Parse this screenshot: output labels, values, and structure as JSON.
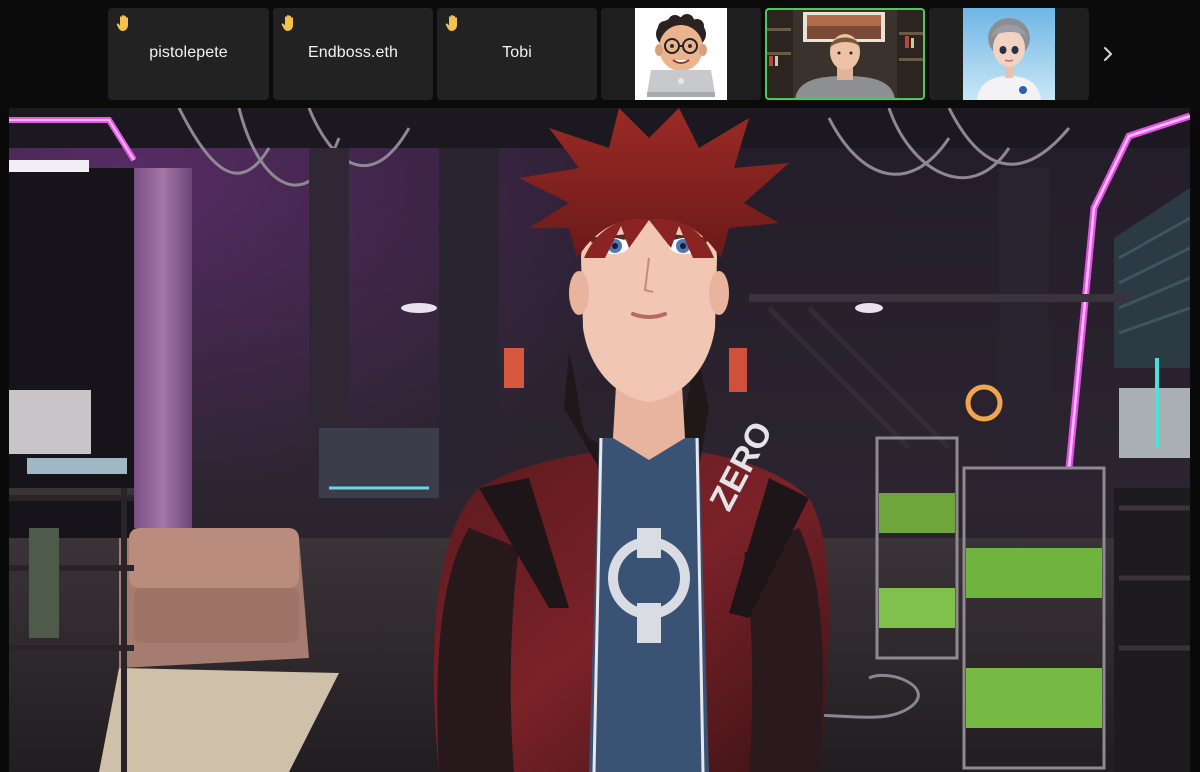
{
  "participants": [
    {
      "name": "pistolepete",
      "raised_hand": true,
      "type": "name-tile"
    },
    {
      "name": "Endboss.eth",
      "raised_hand": true,
      "type": "name-tile"
    },
    {
      "name": "Tobi",
      "raised_hand": true,
      "type": "name-tile"
    },
    {
      "name": "",
      "raised_hand": false,
      "type": "empty-tile"
    },
    {
      "name": "",
      "raised_hand": false,
      "type": "memoji-avatar"
    },
    {
      "name": "",
      "raised_hand": false,
      "type": "webcam-video",
      "active_speaker": true
    },
    {
      "name": "",
      "raised_hand": false,
      "type": "3d-avatar"
    }
  ],
  "icons": {
    "raised_hand": "raised-hand-icon",
    "next": "chevron-right-icon"
  },
  "colors": {
    "active_speaker_border": "#4cc95a",
    "tile_background": "#222222",
    "page_background": "#0b0b0b",
    "hand_color": "#f2c14e"
  },
  "main_video": {
    "jacket_text": "ZERO"
  }
}
